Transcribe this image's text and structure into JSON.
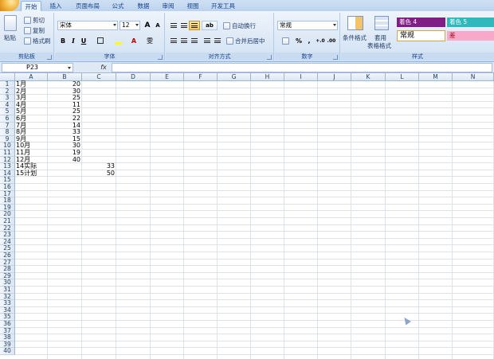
{
  "tabs": [
    "开始",
    "插入",
    "页面布局",
    "公式",
    "数据",
    "审阅",
    "视图",
    "开发工具"
  ],
  "active_tab": "开始",
  "clipboard": {
    "paste": "粘贴",
    "cut": "剪切",
    "copy": "复制",
    "format_painter": "格式刷",
    "label": "剪贴板"
  },
  "font": {
    "name": "宋体",
    "size": "12",
    "bold": "B",
    "italic": "I",
    "underline": "U",
    "grow": "A",
    "shrink": "A",
    "fill": "A",
    "wen": "雯",
    "label": "字体"
  },
  "alignment": {
    "wrap": "自动换行",
    "merge": "合并后居中",
    "label": "对齐方式"
  },
  "number": {
    "format": "常规",
    "percent": "%",
    "comma": ",",
    "label": "数字"
  },
  "styles": {
    "conditional": "条件格式",
    "table_line1": "套用",
    "table_line2": "表格格式",
    "swatch1": "着色 4",
    "swatch2": "着色 5",
    "normal": "常规",
    "swatch3": "差",
    "label": "样式",
    "colors": {
      "swatch1": "#7f1f86",
      "swatch2": "#2fb9bd",
      "swatch3": "#f8a8c8"
    }
  },
  "formula_bar": {
    "name_box": "P23",
    "fx": "fx",
    "content": ""
  },
  "sheet": {
    "columns": [
      "A",
      "B",
      "C",
      "D",
      "E",
      "F",
      "G",
      "H",
      "I",
      "J",
      "K",
      "L",
      "M",
      "N"
    ],
    "row_numbers": [
      "1",
      "2",
      "3",
      "4",
      "5",
      "6",
      "7",
      "8",
      "9",
      "10",
      "11",
      "12",
      "13",
      "14",
      "15",
      "16",
      "17",
      "18",
      "19",
      "20",
      "21",
      "22",
      "23",
      "24",
      "25",
      "26",
      "27",
      "28",
      "29",
      "30",
      "31",
      "32",
      "33",
      "34",
      "35",
      "36",
      "37",
      "38",
      "39",
      "40"
    ],
    "rows": [
      {
        "a": "1月",
        "b": "20",
        "c": ""
      },
      {
        "a": "2月",
        "b": "30",
        "c": ""
      },
      {
        "a": "3月",
        "b": "25",
        "c": ""
      },
      {
        "a": "4月",
        "b": "11",
        "c": ""
      },
      {
        "a": "5月",
        "b": "25",
        "c": ""
      },
      {
        "a": "6月",
        "b": "22",
        "c": ""
      },
      {
        "a": "7月",
        "b": "14",
        "c": ""
      },
      {
        "a": "8月",
        "b": "33",
        "c": ""
      },
      {
        "a": "9月",
        "b": "15",
        "c": ""
      },
      {
        "a": "10月",
        "b": "30",
        "c": ""
      },
      {
        "a": "11月",
        "b": "19",
        "c": ""
      },
      {
        "a": "12月",
        "b": "40",
        "c": ""
      },
      {
        "a": "14实际",
        "b": "",
        "c": "33"
      },
      {
        "a": "15计划",
        "b": "",
        "c": "50"
      }
    ]
  }
}
